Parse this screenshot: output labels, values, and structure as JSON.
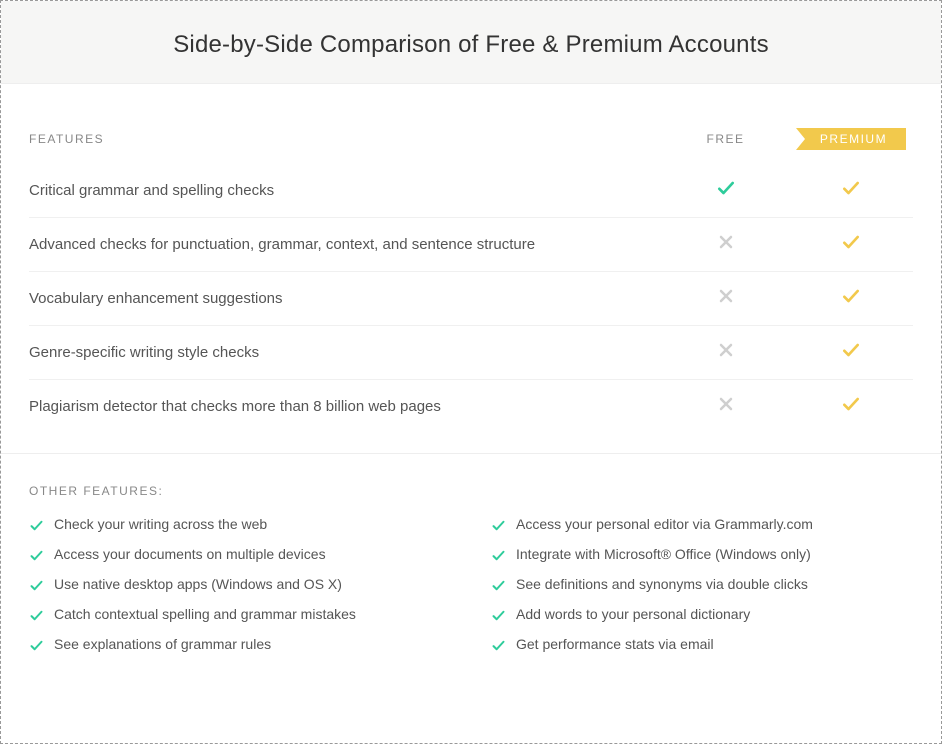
{
  "title": "Side-by-Side Comparison of Free & Premium Accounts",
  "columns": {
    "features": "FEATURES",
    "free": "FREE",
    "premium": "PREMIUM"
  },
  "colors": {
    "green": "#2ecc9b",
    "gold": "#f2c94c",
    "grey": "#cfcfcf"
  },
  "rows": [
    {
      "label": "Critical grammar and spelling checks",
      "free": "check-green",
      "premium": "check-gold"
    },
    {
      "label": "Advanced checks for punctuation, grammar, context, and sentence structure",
      "free": "x-grey",
      "premium": "check-gold"
    },
    {
      "label": "Vocabulary enhancement suggestions",
      "free": "x-grey",
      "premium": "check-gold"
    },
    {
      "label": "Genre-specific writing style checks",
      "free": "x-grey",
      "premium": "check-gold"
    },
    {
      "label": "Plagiarism detector that checks more than 8 billion web pages",
      "free": "x-grey",
      "premium": "check-gold"
    }
  ],
  "other_title": "OTHER FEATURES:",
  "other_left": [
    "Check your writing across the web",
    "Access your documents on multiple devices",
    "Use native desktop apps (Windows and OS X)",
    "Catch contextual spelling and grammar mistakes",
    "See explanations of grammar rules"
  ],
  "other_right": [
    "Access your personal editor via Grammarly.com",
    "Integrate with Microsoft® Office (Windows only)",
    "See definitions and synonyms via double clicks",
    "Add words to your personal dictionary",
    "Get performance stats via email"
  ]
}
